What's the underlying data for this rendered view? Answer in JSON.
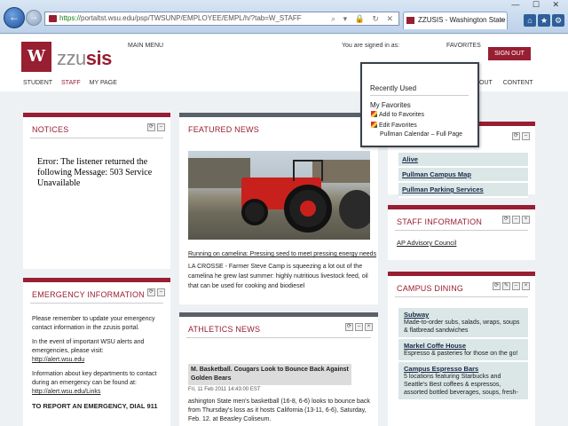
{
  "browser": {
    "url_scheme": "https://",
    "url_rest": "portaltst.wsu.edu/psp/TWSUNP/EMPLOYEE/EMPL/h/?tab=W_STAFF",
    "tab_title": "ZZUSIS - Washington State ...",
    "tab_close": "×",
    "back_label": "←",
    "forward_label": "→",
    "addr_icons": "⌕ ▾ 🔒 ↻ ✕",
    "window_controls": "— ☐ ✕",
    "toolbar_icons": [
      "⌂",
      "★",
      "⚙"
    ]
  },
  "header": {
    "logo_mark": "W",
    "logo_lite": "zzu",
    "logo_bold": "sis",
    "main_menu": "MAIN MENU",
    "signed_in": "You are signed in as:",
    "favorites": "FAVORITES",
    "sign_out": "SIGN OUT",
    "nav": [
      "STUDENT",
      "STAFF",
      "MY PAGE"
    ],
    "right_nav": [
      "OUT",
      "CONTENT"
    ]
  },
  "portlets": {
    "notices": {
      "title": "NOTICES",
      "message": "Error: The listener returned the following Message: 503 Service Unavailable"
    },
    "featured": {
      "title": "FEATURED NEWS",
      "link": "Running on camelina: Pressing seed to meet pressing energy needs",
      "text": "LA CROSSE - Farmer Steve Camp is squeezing a lot out of the camelina he grew last summer: highly nutritious livestock feed, oil that can be used for cooking and biodiesel"
    },
    "quick_links": [
      "Alive",
      "Pullman Campus Map",
      "Pullman Parking Services"
    ],
    "staff_info": {
      "title": "STAFF INFORMATION",
      "link": "AP Advisory Council"
    },
    "emergency": {
      "title": "EMERGENCY INFORMATION",
      "p1": "Please remember to update your emergency contact information in the zzusis portal.",
      "p2": "In the event of important WSU alerts and emergencies, please visit:",
      "p2_link": "http://alert.wsu.edu",
      "p3": "Information about key departments to contact during an emergency can be found at:",
      "p3_link": "http://alert.wsu.edu/Links",
      "p4": "TO REPORT AN EMERGENCY, DIAL 911"
    },
    "athletics": {
      "title": "ATHLETICS NEWS",
      "headline": "M. Basketball. Cougars Look to Bounce Back Against Golden Bears",
      "date": "Fri, 11 Feb 2011 14:43:00 EST",
      "text": "ashington State men's basketball (16-8, 6-6) looks to bounce back from Thursday's loss as it hosts California (13-11, 6-6), Saturday, Feb. 12. at Beasley Coliseum."
    },
    "dining": {
      "title": "CAMPUS DINING",
      "items": [
        {
          "name": "Subway",
          "desc": "Made-to-order subs, salads, wraps, soups & flatbread sandwiches"
        },
        {
          "name": "Markel Coffe House",
          "desc": "Espresso & pasteries for those on the go!"
        },
        {
          "name": "Campus Espresso Bars",
          "desc": "5 locations featuring Starbucks and Seattle's Best coffees & espressos, assorted bottled beverages, soups, fresh-"
        }
      ]
    }
  },
  "favorites_menu": {
    "recently_used": "Recently Used",
    "my_favorites": "My Favorites",
    "add": "Add to Favorites",
    "edit": "Edit Favorites",
    "calendar": "Pullman Calendar – Full Page"
  },
  "controls": {
    "refresh": "⟳",
    "minimize": "–",
    "close": "×",
    "edit": "✎"
  },
  "colors": {
    "brand": "#981e32",
    "dark_bar": "#5a6168",
    "link_bg": "#dbe6e6"
  }
}
